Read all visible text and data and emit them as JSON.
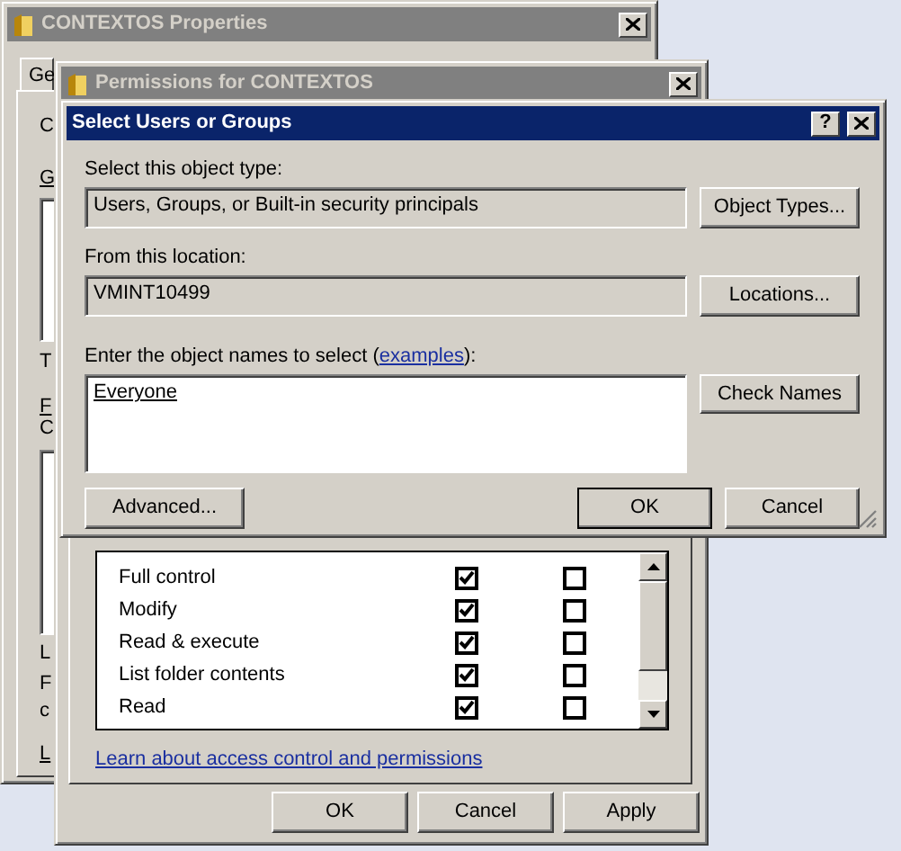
{
  "properties_window": {
    "title": "CONTEXTOS Properties",
    "active": false,
    "tab": "Ge",
    "fragments": [
      {
        "kind": "label",
        "text": "C",
        "underlined": false
      },
      {
        "kind": "label",
        "text": "G",
        "underlined": true
      },
      {
        "kind": "listbox"
      },
      {
        "kind": "label",
        "text": "T",
        "underlined": false
      },
      {
        "kind": "label",
        "text": "F",
        "underlined": true
      },
      {
        "kind": "label",
        "text": "C",
        "underlined": false
      },
      {
        "kind": "listbox"
      },
      {
        "kind": "label",
        "text": "L",
        "underlined": false
      },
      {
        "kind": "label",
        "text": "F",
        "underlined": false
      },
      {
        "kind": "label",
        "text": "c",
        "underlined": false
      },
      {
        "kind": "label",
        "text": "L",
        "underlined": true
      }
    ]
  },
  "permissions_window": {
    "title": "Permissions for CONTEXTOS",
    "active": false,
    "permissions": [
      {
        "name": "Full control",
        "allow": true,
        "deny": false
      },
      {
        "name": "Modify",
        "allow": true,
        "deny": false
      },
      {
        "name": "Read & execute",
        "allow": true,
        "deny": false
      },
      {
        "name": "List folder contents",
        "allow": true,
        "deny": false
      },
      {
        "name": "Read",
        "allow": true,
        "deny": false
      }
    ],
    "link": "Learn about access control and permissions",
    "buttons": [
      {
        "label": "OK",
        "default": false
      },
      {
        "label": "Cancel",
        "default": false
      },
      {
        "label": "Apply",
        "default": false
      }
    ]
  },
  "select_dialog": {
    "title": "Select Users or Groups",
    "active": true,
    "help_button": "?",
    "object_type_label": "Select this object type:",
    "object_type": "Users, Groups, or Built-in security principals",
    "object_types_button": "Object Types...",
    "location_label": "From this location:",
    "location": "VMINT10499",
    "locations_button": "Locations...",
    "names_prompt": {
      "before": "Enter the object names to select (",
      "link": "examples",
      "after": "):"
    },
    "names": "Everyone",
    "names_resolved": true,
    "check_names_button": "Check Names",
    "footer_buttons": [
      {
        "label": "Advanced...",
        "default": false
      },
      {
        "label": "OK",
        "default": true
      },
      {
        "label": "Cancel",
        "default": false
      }
    ]
  }
}
